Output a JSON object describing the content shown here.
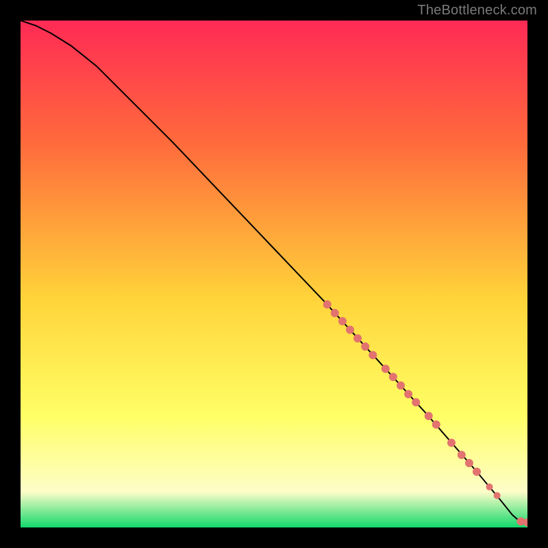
{
  "attribution": "TheBottleneck.com",
  "colors": {
    "background": "#000000",
    "attribution_text": "#7a7a7a",
    "gradient_top": "#ff2a55",
    "gradient_upper_mid": "#ff6a3c",
    "gradient_mid": "#ffd43a",
    "gradient_lower_mid": "#ffff66",
    "gradient_pale": "#fdfdc8",
    "gradient_bottom": "#13d86b",
    "curve": "#000000",
    "marker_fill": "#e2736f",
    "marker_stroke": "#e2736f"
  },
  "chart_data": {
    "type": "line",
    "title": "",
    "xlabel": "",
    "ylabel": "",
    "xlim": [
      0,
      100
    ],
    "ylim": [
      0,
      100
    ],
    "series": [
      {
        "name": "curve",
        "x": [
          0,
          3,
          6,
          10,
          15,
          20,
          30,
          40,
          50,
          60,
          70,
          80,
          90,
          95,
          97,
          98.5,
          100
        ],
        "y": [
          100,
          99,
          97.5,
          95,
          91,
          86,
          76,
          65.5,
          55,
          44.5,
          33.5,
          22.5,
          11,
          5,
          2.5,
          1.2,
          1
        ]
      }
    ],
    "markers": {
      "name": "highlighted-points",
      "points": [
        {
          "x": 60.5,
          "y": 44.0,
          "r": 6
        },
        {
          "x": 62.0,
          "y": 42.3,
          "r": 6
        },
        {
          "x": 63.5,
          "y": 40.7,
          "r": 6
        },
        {
          "x": 65.0,
          "y": 39.0,
          "r": 6
        },
        {
          "x": 66.5,
          "y": 37.3,
          "r": 6
        },
        {
          "x": 68.0,
          "y": 35.7,
          "r": 6
        },
        {
          "x": 69.5,
          "y": 34.0,
          "r": 6
        },
        {
          "x": 72.0,
          "y": 31.3,
          "r": 6
        },
        {
          "x": 73.5,
          "y": 29.7,
          "r": 6
        },
        {
          "x": 75.0,
          "y": 28.0,
          "r": 6
        },
        {
          "x": 76.5,
          "y": 26.3,
          "r": 6
        },
        {
          "x": 78.0,
          "y": 24.7,
          "r": 6
        },
        {
          "x": 80.5,
          "y": 22.0,
          "r": 6
        },
        {
          "x": 82.0,
          "y": 20.3,
          "r": 6
        },
        {
          "x": 85.0,
          "y": 16.7,
          "r": 6
        },
        {
          "x": 87.0,
          "y": 14.3,
          "r": 6
        },
        {
          "x": 88.5,
          "y": 12.7,
          "r": 6
        },
        {
          "x": 90.0,
          "y": 11.0,
          "r": 6
        },
        {
          "x": 92.5,
          "y": 8.0,
          "r": 5
        },
        {
          "x": 94.0,
          "y": 6.3,
          "r": 5
        },
        {
          "x": 98.7,
          "y": 1.2,
          "r": 6
        },
        {
          "x": 100.0,
          "y": 1.0,
          "r": 6
        }
      ]
    }
  }
}
